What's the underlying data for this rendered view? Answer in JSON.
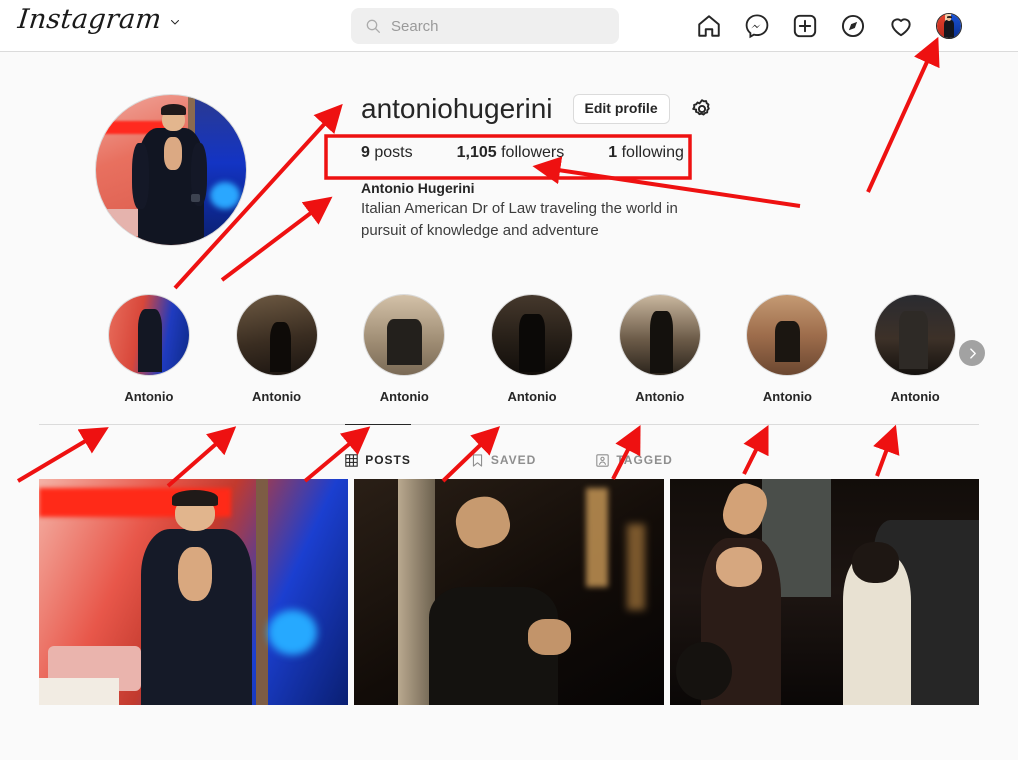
{
  "app": {
    "name": "Instagram",
    "brand_dropdown_icon": "chevron-down-icon"
  },
  "search": {
    "placeholder": "Search",
    "value": "",
    "icon": "search-icon"
  },
  "nav": {
    "items": [
      {
        "icon": "home-icon",
        "label": "Home"
      },
      {
        "icon": "messenger-icon",
        "label": "Messenger"
      },
      {
        "icon": "new-post-icon",
        "label": "New post"
      },
      {
        "icon": "explore-compass-icon",
        "label": "Explore"
      },
      {
        "icon": "heart-icon",
        "label": "Notifications"
      },
      {
        "icon": "profile-avatar",
        "label": "Profile"
      }
    ]
  },
  "profile": {
    "username": "antoniohugerini",
    "edit_button_label": "Edit profile",
    "settings_icon": "gear-icon",
    "stats": [
      {
        "value": "9",
        "label": "posts"
      },
      {
        "value": "1,105",
        "label": "followers"
      },
      {
        "value": "1",
        "label": "following"
      }
    ],
    "full_name": "Antonio Hugerini",
    "bio": "Italian American Dr of Law traveling the world in pursuit of knowledge and adventure"
  },
  "highlights": {
    "next_icon": "chevron-right-icon",
    "items": [
      {
        "label": "Antonio"
      },
      {
        "label": "Antonio"
      },
      {
        "label": "Antonio"
      },
      {
        "label": "Antonio"
      },
      {
        "label": "Antonio"
      },
      {
        "label": "Antonio"
      },
      {
        "label": "Antonio"
      }
    ]
  },
  "tabs": [
    {
      "label": "POSTS",
      "icon": "grid-icon",
      "active": true
    },
    {
      "label": "SAVED",
      "icon": "bookmark-icon",
      "active": false
    },
    {
      "label": "TAGGED",
      "icon": "tagged-person-icon",
      "active": false
    }
  ],
  "posts": [
    {
      "alt": "Man in dark shirt in red and blue lit room"
    },
    {
      "alt": "Man leaning against pillar in dim warm light"
    },
    {
      "alt": "People on a motorcycle at night"
    }
  ],
  "annotations": {
    "color": "#ee1111",
    "highlight_box": "stats-row",
    "arrows": 11
  }
}
